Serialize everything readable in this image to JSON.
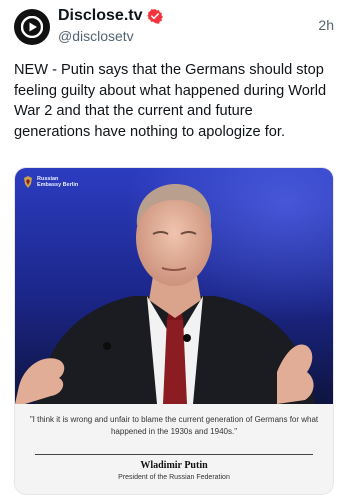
{
  "post": {
    "display_name": "Disclose.tv",
    "handle": "@disclosetv",
    "time": "2h",
    "text": "NEW - Putin says that the Germans should stop feeling guilty about what happened during World War 2 and that the current and future generations have nothing to apologize for.",
    "avatar_icon": "play-icon",
    "verified_icon": "verified-badge-icon",
    "verified_color": "#f4333d"
  },
  "media": {
    "watermark_line1": "Russian",
    "watermark_line2": "Embassy Berlin",
    "quote": "\"I think it is wrong and unfair to blame the current generation of Germans for what happened in the 1930s and 1940s.\"",
    "attribution_name": "Wladimir Putin",
    "attribution_title": "President of the Russian Federation",
    "photo_bg_color": "#1e2a9a"
  }
}
